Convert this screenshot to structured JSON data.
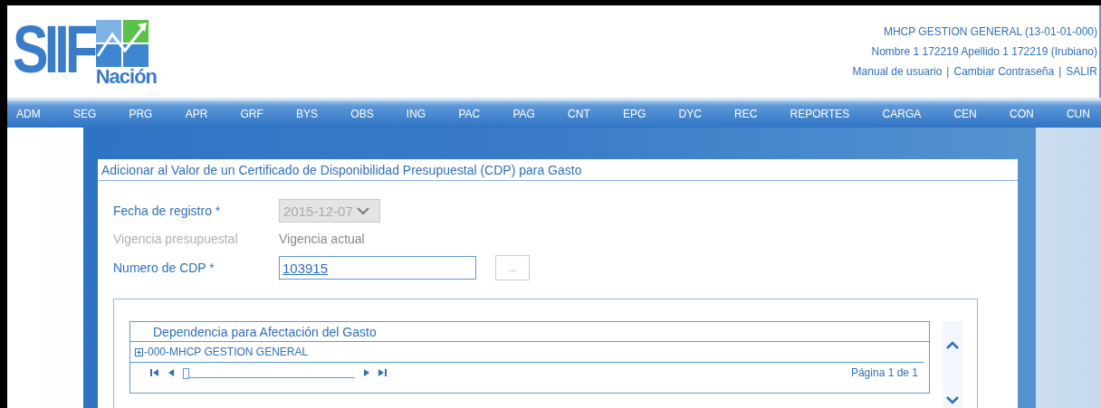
{
  "logo": {
    "letters": "SIIF",
    "subtitle": "Nación"
  },
  "user": {
    "entity": "MHCP GESTION GENERAL (13-01-01-000)",
    "name": "Nombre 1 172219 Apellido 1 172219 (Irubiano)",
    "separator": "|",
    "links": [
      "Manual de usuario",
      "Cambiar Contraseña",
      "SALIR"
    ]
  },
  "menu": [
    "ADM",
    "SEG",
    "PRG",
    "APR",
    "GRF",
    "BYS",
    "OBS",
    "ING",
    "PAC",
    "PAG",
    "CNT",
    "EPG",
    "DYC",
    "REC",
    "REPORTES",
    "CARGA",
    "CEN",
    "CON",
    "CUN"
  ],
  "form": {
    "title": "Adicionar al Valor de un Certificado de Disponibilidad Presupuestal (CDP) para Gasto",
    "fields": [
      {
        "kind": "select",
        "label": "Fecha de registro *",
        "value": "2015-12-07",
        "disabled": true
      },
      {
        "kind": "static",
        "label": "Vigencia presupuestal",
        "value": "Vigencia actual",
        "disabled": true
      },
      {
        "kind": "lookup",
        "label": "Numero de CDP *",
        "value": "103915",
        "button": "...",
        "disabled": false
      }
    ]
  },
  "grid": {
    "column": "Dependencia para Afectación del Gasto",
    "rows": [
      {
        "label": "-000-MHCP GESTION GENERAL",
        "expanded": false
      }
    ],
    "pager": {
      "page_text": "Página 1 de 1",
      "level": 0
    }
  }
}
